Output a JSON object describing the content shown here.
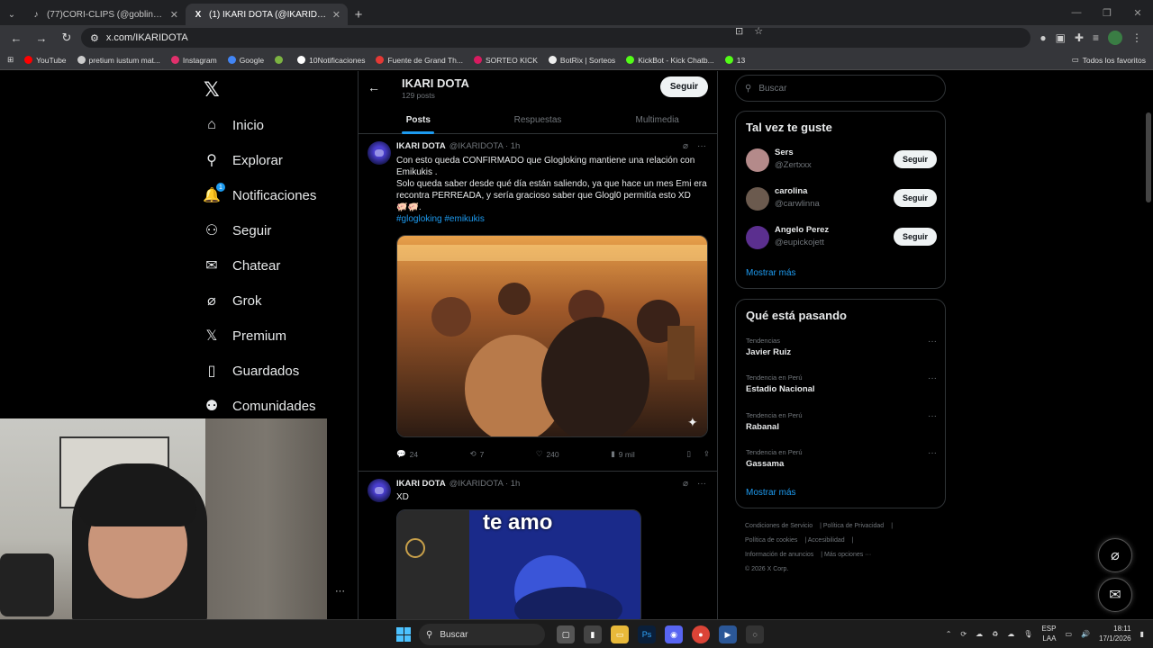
{
  "browser": {
    "tabs": [
      {
        "label": "(77)CORI-CLIPS (@goblincianot",
        "icon": "tiktok-icon",
        "active": false
      },
      {
        "label": "(1) IKARI DOTA (@IKARIDOTA) /",
        "icon": "x-logo-icon",
        "active": true
      }
    ],
    "url": "x.com/IKARIDOTA",
    "bookmarks": [
      {
        "label": "YouTube",
        "color": "#ff0000"
      },
      {
        "label": "pretium iustum mat...",
        "color": "#cccccc"
      },
      {
        "label": "Instagram",
        "color": "#e1306c"
      },
      {
        "label": "Google",
        "color": "#4285f4"
      },
      {
        "label": "",
        "color": "#7cb342"
      },
      {
        "label": "10Notificaciones",
        "color": "#ffffff"
      },
      {
        "label": "Fuente de Grand Th...",
        "color": "#e53935"
      },
      {
        "label": "SORTEO KICK",
        "color": "#d81b60"
      },
      {
        "label": "BotRix | Sorteos",
        "color": "#eeeeee"
      },
      {
        "label": "KickBot - Kick Chatb...",
        "color": "#53fc18"
      },
      {
        "label": "13",
        "color": "#53fc18"
      }
    ],
    "bookmarks_right": "Todos los favoritos"
  },
  "nav": {
    "items": [
      {
        "label": "Inicio",
        "icon": "home-icon",
        "glyph": "⌂"
      },
      {
        "label": "Explorar",
        "icon": "search-icon",
        "glyph": "⚲"
      },
      {
        "label": "Notificaciones",
        "icon": "bell-icon",
        "glyph": "🔔"
      },
      {
        "label": "Seguir",
        "icon": "add-user-icon",
        "glyph": "⚇"
      },
      {
        "label": "Chatear",
        "icon": "mail-icon",
        "glyph": "✉"
      },
      {
        "label": "Grok",
        "icon": "grok-icon",
        "glyph": "⌀"
      },
      {
        "label": "Premium",
        "icon": "x-logo-icon",
        "glyph": "𝕏"
      },
      {
        "label": "Guardados",
        "icon": "bookmark-icon",
        "glyph": "▯"
      },
      {
        "label": "Comunidades",
        "icon": "communities-icon",
        "glyph": "⚉"
      }
    ],
    "notif_badge": "1"
  },
  "profile": {
    "name": "IKARI DOTA",
    "posts": "129 posts",
    "follow_label": "Seguir",
    "tabs": [
      "Posts",
      "Respuestas",
      "Multimedia"
    ]
  },
  "tweets": [
    {
      "name": "IKARI DOTA",
      "handle": "@IKARIDOTA · 1h",
      "text1": "Con esto queda CONFIRMADO que Glogloking mantiene una relación con Emikukis .",
      "text2": "Solo queda saber desde qué día están saliendo, ya que hace un mes Emi era recontra PERREADA, y sería gracioso saber que Glogl0 permitía esto XD",
      "emoji": "🐖🐖.",
      "hashtags": "#glogloking #emikukis",
      "replies": "24",
      "retweets": "7",
      "likes": "240",
      "views": "9 mil"
    },
    {
      "name": "IKARI DOTA",
      "handle": "@IKARIDOTA · 1h",
      "text1": "XD",
      "media_caption": "te amo"
    }
  ],
  "right": {
    "search_placeholder": "Buscar",
    "suggest_title": "Tal vez te guste",
    "suggestions": [
      {
        "name": "Sers",
        "handle": "@Zertxxx",
        "btn": "Seguir",
        "color": "#b48a8a"
      },
      {
        "name": "carolina",
        "handle": "@carwlinna",
        "btn": "Seguir",
        "color": "#6b5a4e"
      },
      {
        "name": "Angelo Perez",
        "handle": "@eupickojett",
        "btn": "Seguir",
        "color": "#5b2f8f"
      }
    ],
    "show_more": "Mostrar más",
    "trending_title": "Qué está pasando",
    "trends": [
      {
        "context": "Tendencias",
        "topic": "Javier Ruiz"
      },
      {
        "context": "Tendencia en Perú",
        "topic": "Estadio Nacional"
      },
      {
        "context": "Tendencia en Perú",
        "topic": "Rabanal"
      },
      {
        "context": "Tendencia en Perú",
        "topic": "Gassama"
      }
    ],
    "show_more2": "Mostrar más",
    "footer": [
      "Condiciones de Servicio",
      "Política de Privacidad",
      "Política de cookies",
      "Accesibilidad",
      "Información de anuncios",
      "Más opciones ···",
      "© 2026 X Corp."
    ]
  },
  "taskbar": {
    "search": "Buscar",
    "lang1": "ESP",
    "lang2": "LAA",
    "time": "18:11",
    "date": "17/1/2026"
  }
}
